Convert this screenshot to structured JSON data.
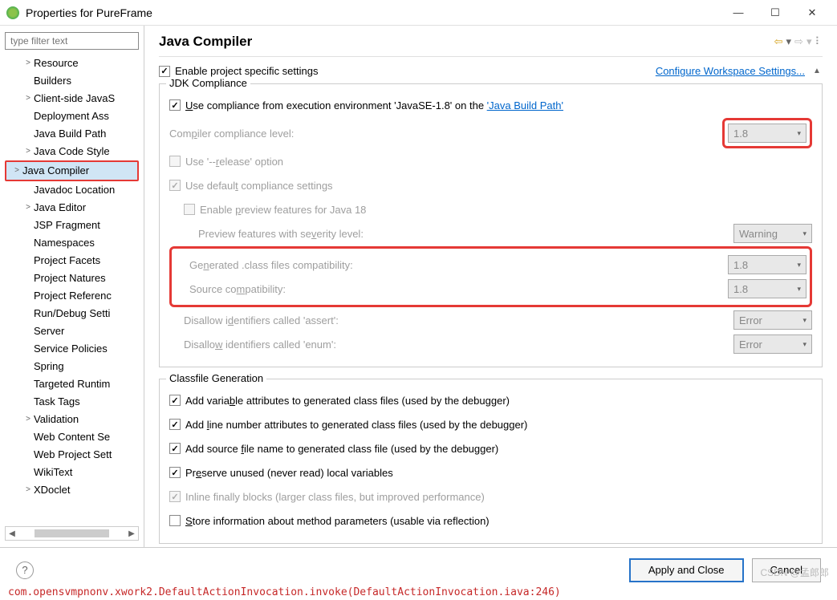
{
  "window": {
    "title": "Properties for PureFrame"
  },
  "filter_placeholder": "type filter text",
  "tree": [
    {
      "label": "Resource",
      "exp": true
    },
    {
      "label": "Builders"
    },
    {
      "label": "Client-side JavaS",
      "exp": true
    },
    {
      "label": "Deployment Ass"
    },
    {
      "label": "Java Build Path"
    },
    {
      "label": "Java Code Style",
      "exp": true
    },
    {
      "label": "Java Compiler",
      "exp": true,
      "selected": true
    },
    {
      "label": "Javadoc Location"
    },
    {
      "label": "Java Editor",
      "exp": true
    },
    {
      "label": "JSP Fragment"
    },
    {
      "label": "Namespaces"
    },
    {
      "label": "Project Facets"
    },
    {
      "label": "Project Natures"
    },
    {
      "label": "Project Referenc"
    },
    {
      "label": "Run/Debug Setti"
    },
    {
      "label": "Server"
    },
    {
      "label": "Service Policies"
    },
    {
      "label": "Spring"
    },
    {
      "label": "Targeted Runtim"
    },
    {
      "label": "Task Tags"
    },
    {
      "label": "Validation",
      "exp": true
    },
    {
      "label": "Web Content Se"
    },
    {
      "label": "Web Project Sett"
    },
    {
      "label": "WikiText"
    },
    {
      "label": "XDoclet",
      "exp": true
    }
  ],
  "page_title": "Java Compiler",
  "enable_specific": "Enable project specific settings",
  "configure_ws": "Configure Workspace Settings...",
  "jdk": {
    "title": "JDK Compliance",
    "use_exec_prefix": "Use compliance from execution environment 'JavaSE-1.8' on the ",
    "build_path_link": "'Java Build Path'",
    "compliance_label": "Compiler compliance level:",
    "compliance_val": "1.8",
    "release_opt": "Use '--release' option",
    "default_compliance": "Use default compliance settings",
    "preview_enable": "Enable preview features for Java 18",
    "preview_severity": "Preview features with severity level:",
    "preview_val": "Warning",
    "class_compat": "Generated .class files compatibility:",
    "class_val": "1.8",
    "source_compat": "Source compatibility:",
    "source_val": "1.8",
    "assert_label": "Disallow identifiers called 'assert':",
    "assert_val": "Error",
    "enum_label": "Disallow identifiers called 'enum':",
    "enum_val": "Error"
  },
  "cls": {
    "title": "Classfile Generation",
    "var_attr": "Add variable attributes to generated class files (used by the debugger)",
    "line_attr": "Add line number attributes to generated class files (used by the debugger)",
    "src_file": "Add source file name to generated class file (used by the debugger)",
    "preserve": "Preserve unused (never read) local variables",
    "inline": "Inline finally blocks (larger class files, but improved performance)",
    "store_params": "Store information about method parameters (usable via reflection)"
  },
  "buttons": {
    "apply": "Apply and Close",
    "cancel": "Cancel"
  },
  "watermark": "CSDN @孟郎郎",
  "under_text": "  com.opensvmpnonv.xwork2.DefaultActionInvocation.invoke(DefaultActionInvocation.iava:246)"
}
